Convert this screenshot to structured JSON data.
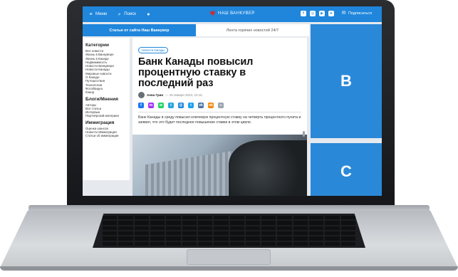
{
  "topbar": {
    "menu_label": "Меню",
    "search_label": "Поиск",
    "logo_text": "НАШ ВАНКУВЕР",
    "subscribe_label": "Подписаться",
    "accent": "#1f86dc",
    "social_icons": [
      "facebook-icon",
      "instagram-icon",
      "youtube-icon",
      "telegram-icon"
    ]
  },
  "tabs": [
    {
      "label": "Статьи от сайта Наш Ванкувер",
      "active": true
    },
    {
      "label": "Лента горячих новостей 24/7",
      "active": false
    }
  ],
  "sidebar": {
    "sections": [
      {
        "heading": "Категории",
        "items": [
          "Все новости",
          "Жизнь в Ванкувере",
          "Жизнь в Канаде",
          "Недвижимость",
          "Новости Ванкувера",
          "Новости Канады",
          "Мировые новости",
          "О Канаде",
          "Путешествия",
          "Технологии",
          "Фото/Видео",
          "Юмор"
        ]
      },
      {
        "heading": "Блоги/Мнения",
        "items": [
          "Авторы",
          "Все статьи",
          "Интервью",
          "Партнёрский материал"
        ]
      },
      {
        "heading": "Иммиграция",
        "items": [
          "Оценка шансов",
          "Новости Иммиграции",
          "Статьи об иммиграции"
        ]
      }
    ]
  },
  "article": {
    "badge": "Новости Канады",
    "title": "Банк Канады повысил процентную ставку в последний раз",
    "author": "Анна Грин",
    "date": "— 25 января 2023, 10:16",
    "share_icons": [
      {
        "name": "facebook-share-icon",
        "color": "#1877f2",
        "glyph": "f"
      },
      {
        "name": "messenger-share-icon",
        "color": "#a334fa",
        "glyph": "m"
      },
      {
        "name": "whatsapp-share-icon",
        "color": "#25d366",
        "glyph": "w"
      },
      {
        "name": "telegram-share-icon",
        "color": "#2aa3df",
        "glyph": "t"
      },
      {
        "name": "email-share-icon",
        "color": "#1f86dc",
        "glyph": "@"
      },
      {
        "name": "twitter-share-icon",
        "color": "#1da1f2",
        "glyph": "t"
      },
      {
        "name": "vk-share-icon",
        "color": "#4a76a8",
        "glyph": "vk"
      },
      {
        "name": "ok-share-icon",
        "color": "#f2890e",
        "glyph": "ok"
      },
      {
        "name": "link-share-icon",
        "color": "#9aa3ad",
        "glyph": "∞"
      }
    ],
    "lead": "Банк Канады в среду повысил ключевую процентную ставку на четверть процентного пункта и заявил, что это будет последнее повышение ставки в этом цикле."
  },
  "ads": {
    "b": "B",
    "c": "C",
    "color": "#2a88d8"
  }
}
